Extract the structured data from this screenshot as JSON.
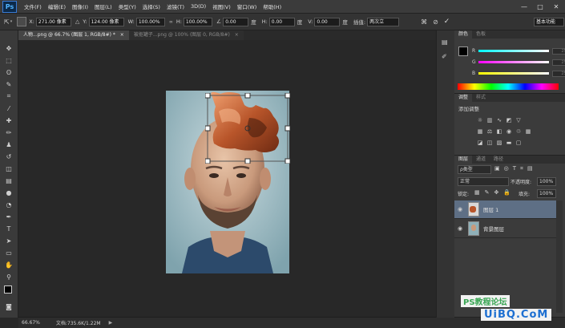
{
  "app": {
    "logo": "Ps"
  },
  "menu": [
    "文件(F)",
    "编辑(E)",
    "图像(I)",
    "图层(L)",
    "类型(Y)",
    "选择(S)",
    "滤镜(T)",
    "3D(D)",
    "视图(V)",
    "窗口(W)",
    "帮助(H)"
  ],
  "window_controls": {
    "minimize": "—",
    "maximize": "□",
    "close": "✕"
  },
  "options": {
    "x_label": "X:",
    "x_value": "271.00 像素",
    "y_label": "Y:",
    "y_value": "124.00 像素",
    "w_label": "W:",
    "w_value": "100.00%",
    "h_label": "H:",
    "h_value": "100.00%",
    "angle_value": "0.00",
    "angle_unit": "度",
    "hskew_label": "H:",
    "hskew_value": "0.00",
    "hskew_unit": "度",
    "vskew_label": "V:",
    "vskew_value": "0.00",
    "vskew_unit": "度",
    "interp_label": "插值:",
    "interp_value": "两次立",
    "workspace": "基本功能"
  },
  "tabs": [
    {
      "label": "人物...png @ 66.7% (图层 1, RGB/8#) *",
      "close": "×",
      "active": true
    },
    {
      "label": "被抠罐子...png @ 100% (图层 0, RGB/8#)",
      "close": "×",
      "active": false
    }
  ],
  "status": {
    "zoom": "66.67%",
    "doc": "文档:735.6K/1.22M"
  },
  "color_panel": {
    "tab_color": "颜色",
    "tab_swatches": "色板",
    "r_label": "R",
    "g_label": "G",
    "b_label": "B",
    "r_value": "255",
    "g_value": "255",
    "b_value": "255"
  },
  "adjust_panel": {
    "tab_adjust": "调整",
    "tab_styles": "样式",
    "title": "添加调整"
  },
  "layers_panel": {
    "tab_layers": "图层",
    "tab_channels": "通道",
    "tab_paths": "路径",
    "kind": "ρ类型",
    "blend_mode": "正常",
    "opacity_label": "不透明度:",
    "opacity_value": "100%",
    "lock_label": "锁定:",
    "fill_label": "填充:",
    "fill_value": "100%",
    "layers": [
      {
        "name": "图层 1",
        "selected": true
      },
      {
        "name": "背景图层",
        "selected": false
      }
    ]
  },
  "watermark": {
    "brand": "PS教程论坛",
    "site": "UiBQ.CoM"
  }
}
